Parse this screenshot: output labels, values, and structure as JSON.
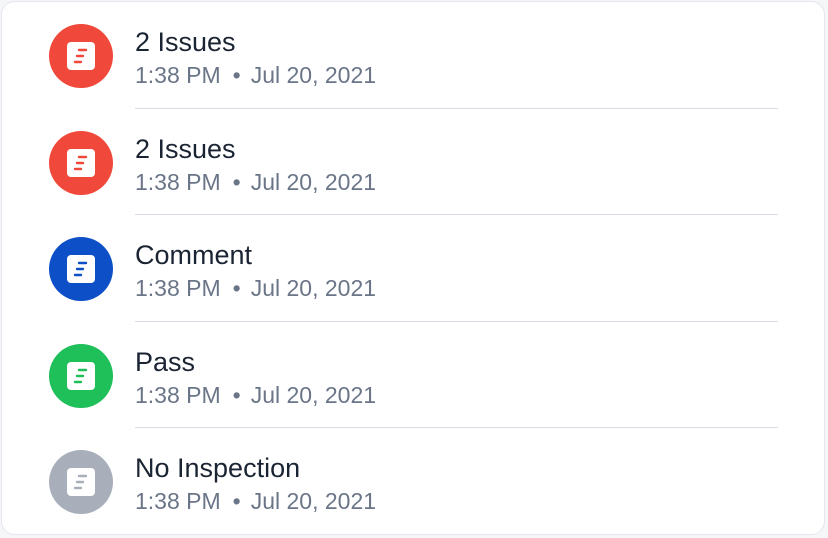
{
  "inspections": [
    {
      "title": "2 Issues",
      "time": "1:38 PM",
      "separator": "•",
      "date": "Jul 20, 2021",
      "status_color": "#f0493b",
      "glyph_color": "#f0493b",
      "icon": "document-icon"
    },
    {
      "title": "2 Issues",
      "time": "1:38 PM",
      "separator": "•",
      "date": "Jul 20, 2021",
      "status_color": "#f0493b",
      "glyph_color": "#f0493b",
      "icon": "document-icon"
    },
    {
      "title": "Comment",
      "time": "1:38 PM",
      "separator": "•",
      "date": "Jul 20, 2021",
      "status_color": "#0d4fc7",
      "glyph_color": "#0d4fc7",
      "icon": "document-icon"
    },
    {
      "title": "Pass",
      "time": "1:38 PM",
      "separator": "•",
      "date": "Jul 20, 2021",
      "status_color": "#1fbf5a",
      "glyph_color": "#1fbf5a",
      "icon": "document-icon"
    },
    {
      "title": "No Inspection",
      "time": "1:38 PM",
      "separator": "•",
      "date": "Jul 20, 2021",
      "status_color": "#a9afba",
      "glyph_color": "#a9afba",
      "icon": "document-icon"
    }
  ]
}
